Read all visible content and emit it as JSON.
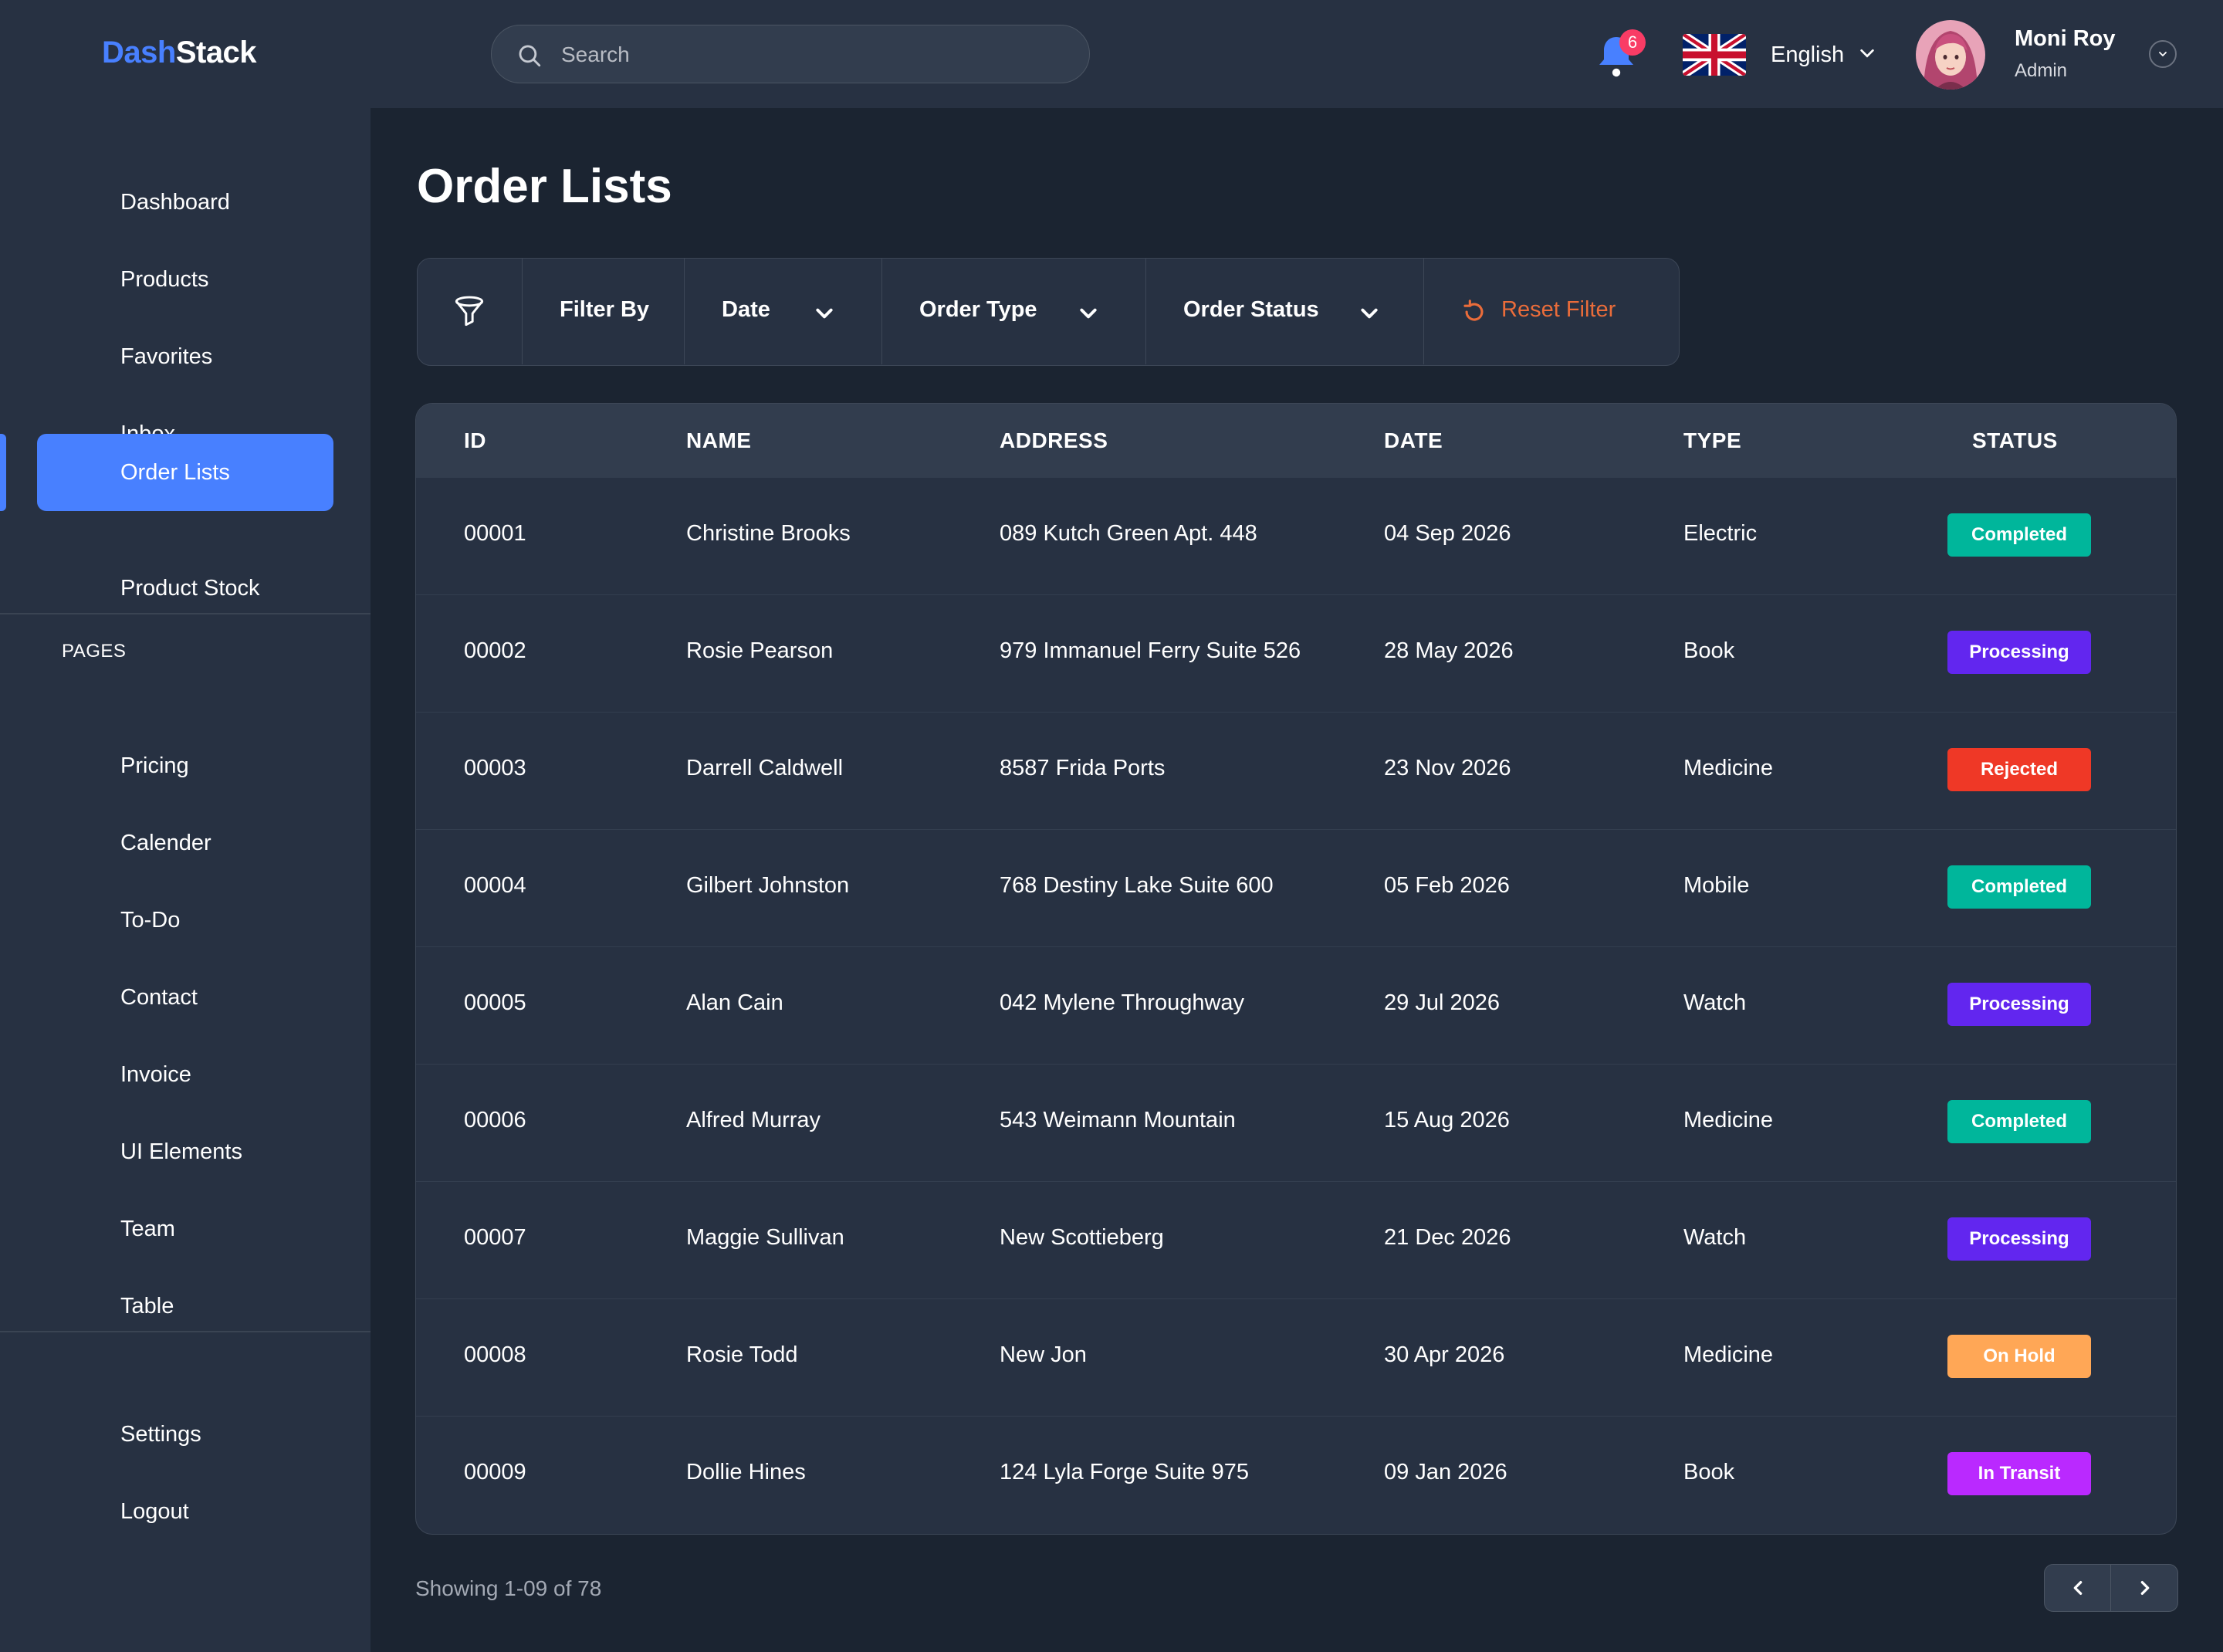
{
  "app": {
    "logo_part1": "Dash",
    "logo_part2": "Stack"
  },
  "header": {
    "search_placeholder": "Search",
    "notification_count": "6",
    "language": "English",
    "user_name": "Moni Roy",
    "user_role": "Admin"
  },
  "sidebar": {
    "items": [
      {
        "label": "Dashboard"
      },
      {
        "label": "Products"
      },
      {
        "label": "Favorites"
      },
      {
        "label": "Inbox"
      },
      {
        "label": "Order Lists"
      },
      {
        "label": "Product Stock"
      }
    ],
    "pages_heading": "PAGES",
    "pages": [
      {
        "label": "Pricing"
      },
      {
        "label": "Calender"
      },
      {
        "label": "To-Do"
      },
      {
        "label": "Contact"
      },
      {
        "label": "Invoice"
      },
      {
        "label": "UI Elements"
      },
      {
        "label": "Team"
      },
      {
        "label": "Table"
      }
    ],
    "bottom": [
      {
        "label": "Settings"
      },
      {
        "label": "Logout"
      }
    ],
    "active_item": "Order Lists"
  },
  "main": {
    "title": "Order Lists",
    "filters": {
      "filter_by": "Filter By",
      "date": "Date",
      "order_type": "Order Type",
      "order_status": "Order Status",
      "reset": "Reset Filter"
    },
    "table": {
      "columns": [
        "ID",
        "NAME",
        "ADDRESS",
        "DATE",
        "TYPE",
        "STATUS"
      ],
      "rows": [
        {
          "id": "00001",
          "name": "Christine Brooks",
          "address": "089 Kutch Green Apt. 448",
          "date": "04 Sep 2026",
          "type": "Electric",
          "status": "Completed"
        },
        {
          "id": "00002",
          "name": "Rosie Pearson",
          "address": "979 Immanuel Ferry Suite 526",
          "date": "28 May 2026",
          "type": "Book",
          "status": "Processing"
        },
        {
          "id": "00003",
          "name": "Darrell Caldwell",
          "address": "8587 Frida Ports",
          "date": "23 Nov 2026",
          "type": "Medicine",
          "status": "Rejected"
        },
        {
          "id": "00004",
          "name": "Gilbert Johnston",
          "address": "768 Destiny Lake Suite 600",
          "date": "05 Feb 2026",
          "type": "Mobile",
          "status": "Completed"
        },
        {
          "id": "00005",
          "name": "Alan Cain",
          "address": "042 Mylene Throughway",
          "date": "29 Jul 2026",
          "type": "Watch",
          "status": "Processing"
        },
        {
          "id": "00006",
          "name": "Alfred Murray",
          "address": "543 Weimann Mountain",
          "date": "15 Aug 2026",
          "type": "Medicine",
          "status": "Completed"
        },
        {
          "id": "00007",
          "name": "Maggie Sullivan",
          "address": "New Scottieberg",
          "date": "21 Dec 2026",
          "type": "Watch",
          "status": "Processing"
        },
        {
          "id": "00008",
          "name": "Rosie Todd",
          "address": "New Jon",
          "date": "30 Apr 2026",
          "type": "Medicine",
          "status": "On Hold"
        },
        {
          "id": "00009",
          "name": "Dollie Hines",
          "address": "124 Lyla Forge Suite 975",
          "date": "09 Jan 2026",
          "type": "Book",
          "status": "In Transit"
        }
      ]
    },
    "pagination": {
      "showing": "Showing 1-09 of 78"
    }
  },
  "colors": {
    "accent": "#4880ff",
    "completed": "#00b69b",
    "processing": "#6226ef",
    "rejected": "#ef3826",
    "on_hold": "#ffa756",
    "in_transit": "#ba29ff",
    "reset": "#ea6c3a"
  },
  "icons": [
    "search-icon",
    "bell-icon",
    "uk-flag-icon",
    "chevron-down-icon",
    "filter-funnel-icon",
    "reset-icon",
    "chevron-left-icon",
    "chevron-right-icon"
  ]
}
